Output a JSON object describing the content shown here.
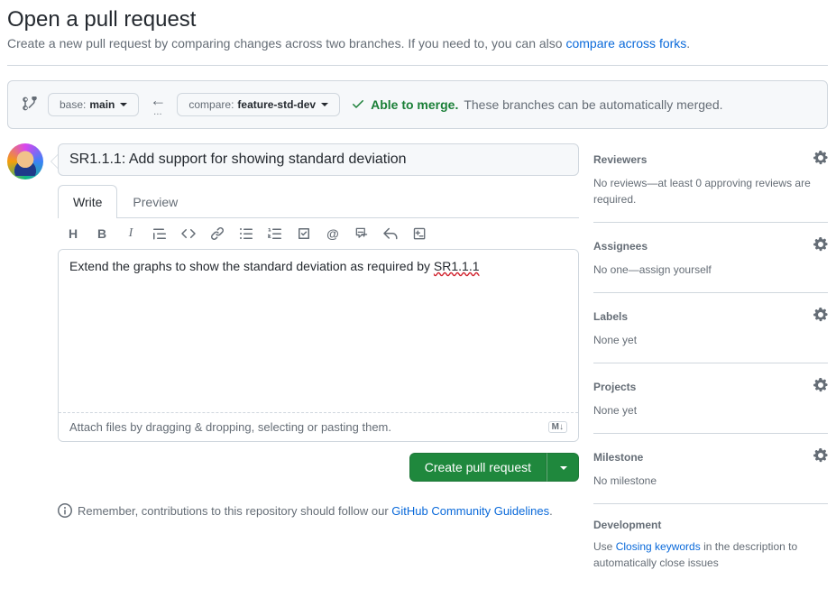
{
  "header": {
    "title": "Open a pull request",
    "subtitle_pre": "Create a new pull request by comparing changes across two branches. If you need to, you can also ",
    "subtitle_link": "compare across forks",
    "subtitle_post": "."
  },
  "branches": {
    "base_label": "base: ",
    "base_value": "main",
    "compare_label": "compare: ",
    "compare_value": "feature-std-dev",
    "able_label": "Able to merge.",
    "able_desc": "These branches can be automatically merged."
  },
  "form": {
    "title_value": "SR1.1.1: Add support for showing standard deviation",
    "tab_write": "Write",
    "tab_preview": "Preview",
    "body_pre": "Extend the graphs to show the standard deviation as required by ",
    "body_err": "SR1.1.1",
    "attach_hint": "Attach files by dragging & dropping, selecting or pasting them.",
    "markdown_badge": "M↓",
    "submit_label": "Create pull request"
  },
  "footer": {
    "pre": "Remember, contributions to this repository should follow our ",
    "link": "GitHub Community Guidelines",
    "post": "."
  },
  "sidebar": {
    "reviewers": {
      "title": "Reviewers",
      "text": "No reviews—at least 0 approving reviews are required."
    },
    "assignees": {
      "title": "Assignees",
      "text_pre": "No one—",
      "link": "assign yourself"
    },
    "labels": {
      "title": "Labels",
      "text": "None yet"
    },
    "projects": {
      "title": "Projects",
      "text": "None yet"
    },
    "milestone": {
      "title": "Milestone",
      "text": "No milestone"
    },
    "development": {
      "title": "Development",
      "pre": "Use ",
      "link": "Closing keywords",
      "post": " in the description to automatically close issues"
    }
  },
  "icons": {
    "heading": "H",
    "bold": "B",
    "italic": "I"
  }
}
